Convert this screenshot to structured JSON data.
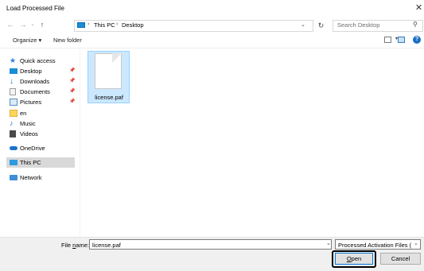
{
  "window": {
    "title": "Load Processed File"
  },
  "address_bar": {
    "crumbs": [
      "This PC",
      "Desktop"
    ],
    "search_placeholder": "Search Desktop"
  },
  "toolbar": {
    "organize": "Organize ▾",
    "new_folder": "New folder"
  },
  "nav": {
    "items": [
      {
        "label": "Quick access",
        "icon": "star-icon",
        "pinned": false,
        "selected": false
      },
      {
        "label": "Desktop",
        "icon": "desktop-icon",
        "pinned": true,
        "selected": false
      },
      {
        "label": "Downloads",
        "icon": "download-icon",
        "pinned": true,
        "selected": false
      },
      {
        "label": "Documents",
        "icon": "document-icon",
        "pinned": true,
        "selected": false
      },
      {
        "label": "Pictures",
        "icon": "pictures-icon",
        "pinned": true,
        "selected": false
      },
      {
        "label": "en",
        "icon": "folder-icon",
        "pinned": false,
        "selected": false
      },
      {
        "label": "Music",
        "icon": "music-icon",
        "pinned": false,
        "selected": false
      },
      {
        "label": "Videos",
        "icon": "video-icon",
        "pinned": false,
        "selected": false
      },
      {
        "label": "OneDrive",
        "icon": "cloud-icon",
        "pinned": false,
        "selected": false
      },
      {
        "label": "This PC",
        "icon": "computer-icon",
        "pinned": false,
        "selected": true
      },
      {
        "label": "Network",
        "icon": "network-icon",
        "pinned": false,
        "selected": false
      }
    ],
    "pin_glyph": "📌"
  },
  "files": [
    {
      "name": "license.paf",
      "selected": true
    }
  ],
  "bottom": {
    "file_name_prefix": "File ",
    "file_name_underlined": "n",
    "file_name_suffix": "ame:",
    "file_name_value": "license.paf",
    "file_type": "Processed Activation Files (*.paf)",
    "open_underlined": "O",
    "open_rest": "pen",
    "cancel": "Cancel"
  },
  "colors": {
    "selection_fill": "#cce8ff",
    "selection_border": "#99d1ff",
    "nav_selected": "#d9d9d9",
    "focus_outline": "#000000",
    "accent_blue": "#0078d7"
  }
}
